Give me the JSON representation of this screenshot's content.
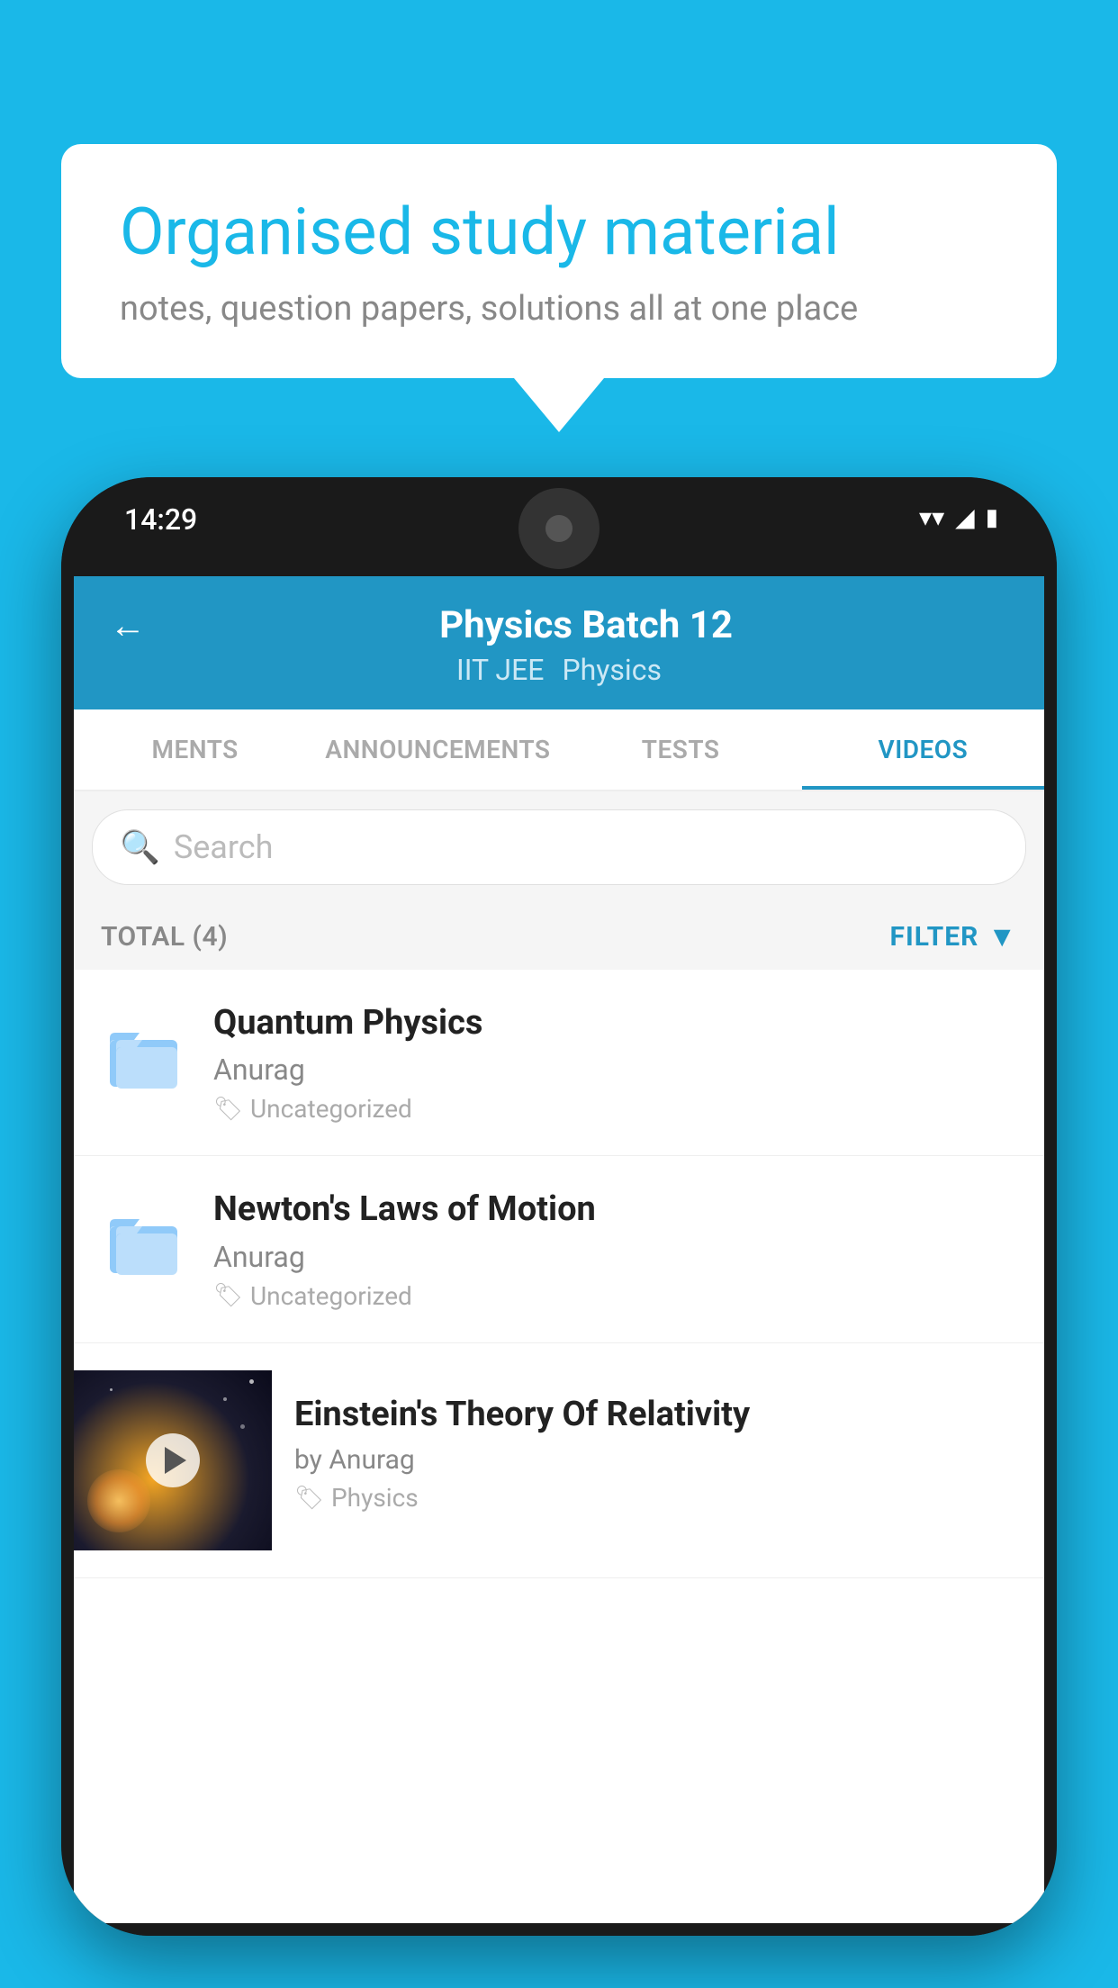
{
  "background_color": "#1ab8e8",
  "speech_bubble": {
    "title": "Organised study material",
    "subtitle": "notes, question papers, solutions all at one place"
  },
  "phone": {
    "status_bar": {
      "time": "14:29",
      "wifi_symbol": "▼",
      "signal_symbol": "▲",
      "battery_symbol": "▮"
    },
    "app": {
      "header": {
        "back_label": "←",
        "title": "Physics Batch 12",
        "tag1": "IIT JEE",
        "tag2": "Physics"
      },
      "tabs": [
        {
          "label": "MENTS",
          "active": false
        },
        {
          "label": "ANNOUNCEMENTS",
          "active": false
        },
        {
          "label": "TESTS",
          "active": false
        },
        {
          "label": "VIDEOS",
          "active": true
        }
      ],
      "search": {
        "placeholder": "Search"
      },
      "filter_bar": {
        "total_label": "TOTAL (4)",
        "filter_label": "FILTER"
      },
      "videos": [
        {
          "id": "quantum",
          "title": "Quantum Physics",
          "author": "Anurag",
          "tag": "Uncategorized",
          "has_thumbnail": false
        },
        {
          "id": "newton",
          "title": "Newton's Laws of Motion",
          "author": "Anurag",
          "tag": "Uncategorized",
          "has_thumbnail": false
        },
        {
          "id": "einstein",
          "title": "Einstein's Theory Of Relativity",
          "author": "by Anurag",
          "tag": "Physics",
          "has_thumbnail": true
        }
      ]
    }
  }
}
